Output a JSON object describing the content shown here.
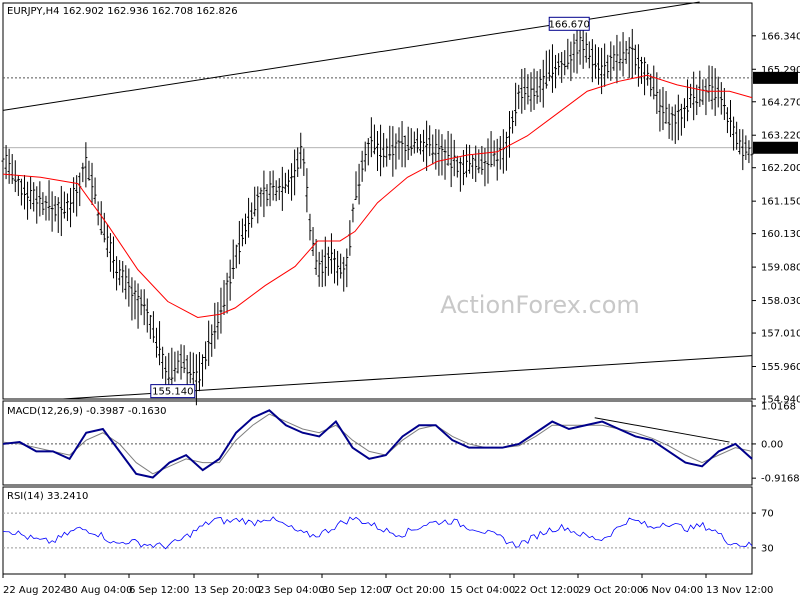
{
  "chart_data": {
    "type": "candlestick",
    "symbol_header": "EURJPY,H4 162.902 162.936 162.708 162.826",
    "watermark": "ActionForex.com",
    "price_axis": {
      "min": 154.94,
      "max": 167.37,
      "ticks": [
        "166.340",
        "165.290",
        "164.270",
        "163.220",
        "162.200",
        "161.150",
        "160.130",
        "159.080",
        "158.030",
        "157.010",
        "155.960",
        "154.940"
      ]
    },
    "levels": {
      "dotted_resistance": 165.02,
      "current_price": 162.826,
      "high_label": "166.670",
      "low_label": "155.140",
      "resistance_badge": "165.020",
      "current_badge": "162.826"
    },
    "x_labels": [
      "22 Aug 2024",
      "30 Aug 04:00",
      "6 Sep 12:00",
      "13 Sep 20:00",
      "23 Sep 04:00",
      "30 Sep 12:00",
      "7 Oct 20:00",
      "15 Oct 04:00",
      "22 Oct 12:00",
      "29 Oct 20:00",
      "6 Nov 04:00",
      "13 Nov 12:00"
    ],
    "series_points": [
      {
        "x": 0,
        "p": 162.6
      },
      {
        "x": 0.02,
        "p": 161.6
      },
      {
        "x": 0.04,
        "p": 161.3
      },
      {
        "x": 0.06,
        "p": 161.0
      },
      {
        "x": 0.08,
        "p": 160.8
      },
      {
        "x": 0.1,
        "p": 161.5
      },
      {
        "x": 0.11,
        "p": 162.4
      },
      {
        "x": 0.12,
        "p": 161.7
      },
      {
        "x": 0.13,
        "p": 160.5
      },
      {
        "x": 0.15,
        "p": 159.2
      },
      {
        "x": 0.17,
        "p": 158.3
      },
      {
        "x": 0.19,
        "p": 157.7
      },
      {
        "x": 0.21,
        "p": 156.5
      },
      {
        "x": 0.22,
        "p": 155.6
      },
      {
        "x": 0.24,
        "p": 156.2
      },
      {
        "x": 0.26,
        "p": 155.5
      },
      {
        "x": 0.27,
        "p": 156.3
      },
      {
        "x": 0.29,
        "p": 157.6
      },
      {
        "x": 0.31,
        "p": 159.4
      },
      {
        "x": 0.33,
        "p": 160.8
      },
      {
        "x": 0.35,
        "p": 161.4
      },
      {
        "x": 0.37,
        "p": 161.6
      },
      {
        "x": 0.39,
        "p": 162.0
      },
      {
        "x": 0.4,
        "p": 162.9
      },
      {
        "x": 0.41,
        "p": 160.4
      },
      {
        "x": 0.42,
        "p": 159.0
      },
      {
        "x": 0.44,
        "p": 159.4
      },
      {
        "x": 0.45,
        "p": 159.0
      },
      {
        "x": 0.46,
        "p": 159.3
      },
      {
        "x": 0.47,
        "p": 161.3
      },
      {
        "x": 0.48,
        "p": 162.4
      },
      {
        "x": 0.49,
        "p": 163.0
      },
      {
        "x": 0.51,
        "p": 162.6
      },
      {
        "x": 0.53,
        "p": 162.9
      },
      {
        "x": 0.55,
        "p": 163.0
      },
      {
        "x": 0.57,
        "p": 162.9
      },
      {
        "x": 0.59,
        "p": 162.6
      },
      {
        "x": 0.61,
        "p": 162.2
      },
      {
        "x": 0.63,
        "p": 162.3
      },
      {
        "x": 0.65,
        "p": 162.5
      },
      {
        "x": 0.67,
        "p": 162.7
      },
      {
        "x": 0.68,
        "p": 163.7
      },
      {
        "x": 0.69,
        "p": 164.6
      },
      {
        "x": 0.71,
        "p": 164.5
      },
      {
        "x": 0.73,
        "p": 165.2
      },
      {
        "x": 0.75,
        "p": 165.5
      },
      {
        "x": 0.77,
        "p": 166.1
      },
      {
        "x": 0.79,
        "p": 165.6
      },
      {
        "x": 0.8,
        "p": 165.3
      },
      {
        "x": 0.82,
        "p": 165.6
      },
      {
        "x": 0.84,
        "p": 165.8
      },
      {
        "x": 0.86,
        "p": 165.2
      },
      {
        "x": 0.88,
        "p": 163.9
      },
      {
        "x": 0.9,
        "p": 163.7
      },
      {
        "x": 0.92,
        "p": 164.4
      },
      {
        "x": 0.94,
        "p": 164.6
      },
      {
        "x": 0.955,
        "p": 164.5
      },
      {
        "x": 0.97,
        "p": 163.6
      },
      {
        "x": 0.985,
        "p": 162.8
      },
      {
        "x": 1,
        "p": 162.8
      }
    ],
    "moving_average": [
      {
        "x": 0,
        "p": 162.0
      },
      {
        "x": 0.05,
        "p": 161.9
      },
      {
        "x": 0.1,
        "p": 161.7
      },
      {
        "x": 0.14,
        "p": 160.4
      },
      {
        "x": 0.18,
        "p": 159.0
      },
      {
        "x": 0.22,
        "p": 158.0
      },
      {
        "x": 0.26,
        "p": 157.5
      },
      {
        "x": 0.29,
        "p": 157.6
      },
      {
        "x": 0.31,
        "p": 157.8
      },
      {
        "x": 0.35,
        "p": 158.5
      },
      {
        "x": 0.39,
        "p": 159.1
      },
      {
        "x": 0.42,
        "p": 159.9
      },
      {
        "x": 0.45,
        "p": 159.9
      },
      {
        "x": 0.47,
        "p": 160.2
      },
      {
        "x": 0.5,
        "p": 161.1
      },
      {
        "x": 0.54,
        "p": 161.9
      },
      {
        "x": 0.58,
        "p": 162.4
      },
      {
        "x": 0.62,
        "p": 162.6
      },
      {
        "x": 0.66,
        "p": 162.7
      },
      {
        "x": 0.7,
        "p": 163.2
      },
      {
        "x": 0.74,
        "p": 163.9
      },
      {
        "x": 0.78,
        "p": 164.6
      },
      {
        "x": 0.82,
        "p": 164.9
      },
      {
        "x": 0.86,
        "p": 165.1
      },
      {
        "x": 0.9,
        "p": 164.8
      },
      {
        "x": 0.94,
        "p": 164.6
      },
      {
        "x": 0.97,
        "p": 164.6
      },
      {
        "x": 1,
        "p": 164.4
      }
    ],
    "trendlines": [
      {
        "x1": 0,
        "p1": 164.0,
        "x2": 0.93,
        "p2": 167.4
      },
      {
        "x1": 0.08,
        "p1": 154.94,
        "x2": 1.02,
        "p2": 156.3
      }
    ],
    "macd": {
      "title": "MACD(12,26,9) -0.3987 -0.1630",
      "ticks": [
        "1.0168",
        "0.00",
        "-0.9168"
      ],
      "min": -1.1,
      "max": 1.15,
      "main": [
        0.0,
        0.05,
        -0.2,
        -0.2,
        -0.4,
        0.3,
        0.4,
        -0.2,
        -0.8,
        -0.9,
        -0.5,
        -0.3,
        -0.7,
        -0.4,
        0.3,
        0.7,
        0.9,
        0.5,
        0.3,
        0.2,
        0.6,
        -0.1,
        -0.4,
        -0.3,
        0.2,
        0.5,
        0.5,
        0.1,
        -0.1,
        -0.1,
        -0.1,
        0.0,
        0.3,
        0.6,
        0.4,
        0.5,
        0.6,
        0.4,
        0.2,
        0.1,
        -0.2,
        -0.5,
        -0.6,
        -0.2,
        0.0,
        -0.4
      ],
      "signal": [
        0.05,
        0.0,
        -0.1,
        -0.2,
        -0.3,
        0.1,
        0.3,
        0.0,
        -0.5,
        -0.8,
        -0.6,
        -0.4,
        -0.5,
        -0.5,
        0.1,
        0.5,
        0.8,
        0.6,
        0.4,
        0.3,
        0.5,
        0.1,
        -0.2,
        -0.3,
        0.1,
        0.4,
        0.5,
        0.2,
        0.0,
        -0.1,
        -0.1,
        -0.05,
        0.2,
        0.5,
        0.5,
        0.5,
        0.5,
        0.4,
        0.3,
        0.15,
        -0.05,
        -0.3,
        -0.5,
        -0.3,
        -0.1,
        -0.2
      ]
    },
    "rsi": {
      "title": "RSI(14) 33.2410",
      "ticks": [
        "70",
        "30"
      ],
      "min": 0,
      "max": 100,
      "values": [
        52,
        48,
        42,
        38,
        37,
        45,
        52,
        50,
        44,
        34,
        38,
        35,
        33,
        32,
        37,
        46,
        55,
        63,
        60,
        63,
        58,
        65,
        60,
        53,
        46,
        44,
        50,
        58,
        64,
        60,
        54,
        48,
        46,
        52,
        58,
        60,
        61,
        55,
        52,
        46,
        41,
        33,
        38,
        46,
        52,
        54,
        47,
        42,
        40,
        50,
        62,
        60,
        52,
        60,
        55,
        52,
        56,
        50,
        38,
        34,
        33
      ],
      "legend_hint": "none"
    },
    "colors": {
      "price": "#000000",
      "ma": "#ff0000",
      "macd": "#00008b",
      "signal": "#808080",
      "rsi": "#0000ff",
      "grid": "#c8c8c8"
    }
  }
}
